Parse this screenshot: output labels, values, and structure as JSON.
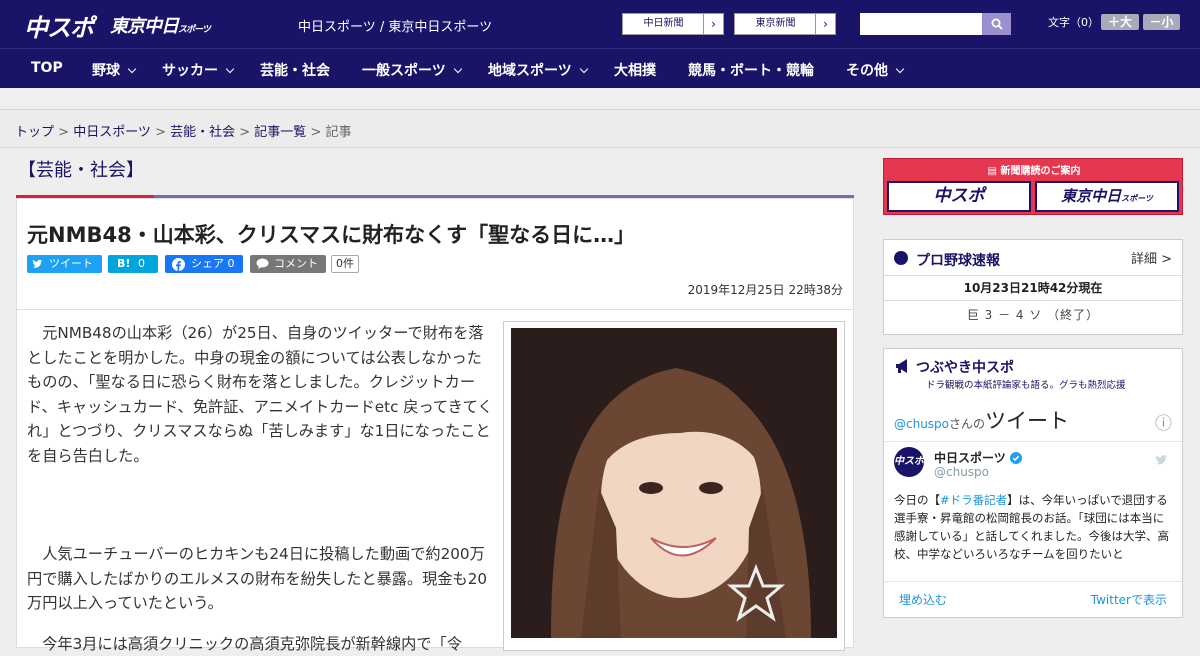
{
  "header": {
    "logo_chuspo": "中スポ",
    "logo_tokyo": "東京中日",
    "logo_sports": "スポーツ",
    "site_name": "中日スポーツ / 東京中日スポーツ",
    "btn_chunichi": "中日新聞",
    "btn_tokyo": "東京新聞",
    "arrow": "›",
    "search_placeholder": "",
    "font_size_label": "文字（0）",
    "font_plus": "＋大",
    "font_minus": "－小"
  },
  "nav": {
    "items": [
      {
        "label": "TOP"
      },
      {
        "label": "野球"
      },
      {
        "label": "サッカー"
      },
      {
        "label": "芸能・社会"
      },
      {
        "label": "一般スポーツ"
      },
      {
        "label": "地域スポーツ"
      },
      {
        "label": "大相撲"
      },
      {
        "label": "競馬・ボート・競輪"
      },
      {
        "label": "その他"
      }
    ]
  },
  "breadcrumb": {
    "items": [
      "トップ",
      "中日スポーツ",
      "芸能・社会",
      "記事一覧",
      "記事"
    ],
    "sep": " > "
  },
  "article": {
    "category": "【芸能・社会】",
    "title": "元NMB48・山本彩、クリスマスに財布なくす「聖なる日に…」",
    "share_tweet": "ツイート",
    "share_hatena": "B!",
    "share_hatena_count": "0",
    "share_fb": "シェア",
    "share_fb_count": "0",
    "share_comment": "コメント",
    "comment_count": "0件",
    "date": "2019年12月25日 22時38分",
    "p1": "元NMB48の山本彩（26）が25日、自身のツイッターで財布を落としたことを明かした。中身の現金の額については公表しなかったものの、「聖なる日に恐らく財布を落としました。クレジットカード、キャッシュカード、免許証、アニメイトカードetc 戻ってきてくれ」とつづり、クリスマスならぬ「苦しみます」な1日になったことを自ら告白した。",
    "p2": "人気ユーチューバーのヒカキンも24日に投稿した動画で約200万円で購入したばかりのエルメスの財布を紛失したと暴露。現金も20万円以上入っていたという。",
    "p3": "今年3月には高須クリニックの高須克弥院長が新幹線内で「令"
  },
  "sidebar": {
    "subscribe_title": "新聞購読のご案内",
    "subscribe_chuspo": "中スポ",
    "subscribe_tokyo": "東京中日",
    "subscribe_tokyo_small": "スポーツ",
    "baseball_title": "プロ野球速報",
    "baseball_detail": "詳細 >",
    "baseball_time": "10月23日21時42分現在",
    "baseball_score": "巨 3 － 4 ソ （終了）",
    "tweet_title": "つぶやき中スポ",
    "tweet_subtitle": "ドラ観戦の本紙評論家も語る。グラも熱烈応援",
    "tweet_user": "@chuspo",
    "tweet_san": "さんの",
    "tweet_heading": "ツイート",
    "tweet_info": "ⓘ",
    "tweet_name": "中日スポーツ",
    "tweet_handle": "@chuspo",
    "tweet_avatar": "中スポ",
    "tweet_text_a": "今日の【",
    "tweet_hashtag": "#ドラ番記者",
    "tweet_text_b": "】は、今年いっぱいで退団する選手寮・昇竜館の松岡館長のお話。「球団には本当に感謝している」と話してくれました。今後は大学、高校、中学などいろいろなチームを回りたいと",
    "embed": "埋め込む",
    "view_twitter": "Twitterで表示"
  }
}
